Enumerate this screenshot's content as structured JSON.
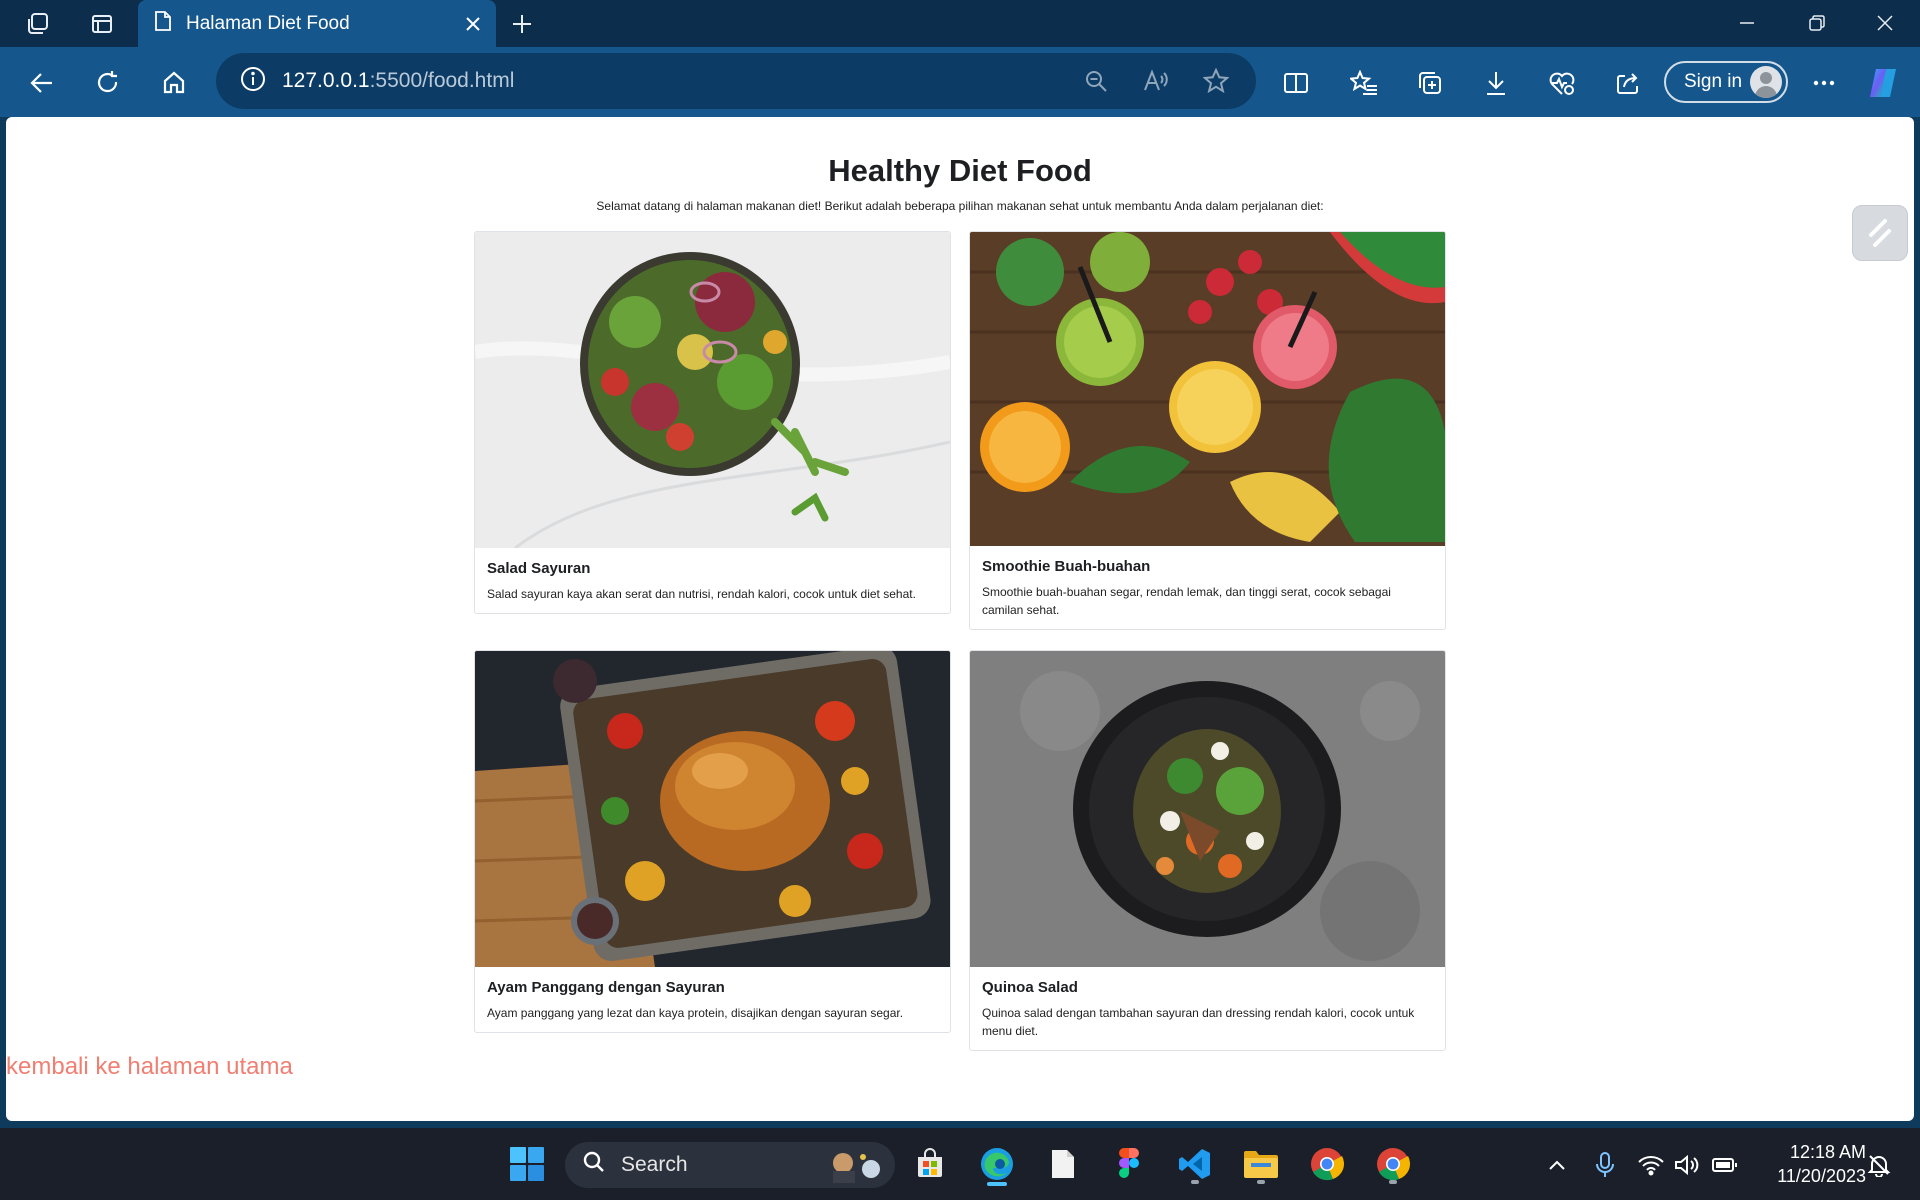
{
  "browser": {
    "tab_title": "Halaman Diet Food",
    "url_host": "127.0.0.1",
    "url_rest": ":5500/food.html",
    "sign_in": "Sign in"
  },
  "page": {
    "title": "Healthy Diet Food",
    "intro": "Selamat datang di halaman makanan diet! Berikut adalah beberapa pilihan makanan sehat untuk membantu Anda dalam perjalanan diet:",
    "back_link": "kembali ke halaman utama",
    "cards": [
      {
        "title": "Salad Sayuran",
        "text": "Salad sayuran kaya akan serat dan nutrisi, rendah kalori, cocok untuk diet sehat."
      },
      {
        "title": "Smoothie Buah-buahan",
        "text": "Smoothie buah-buahan segar, rendah lemak, dan tinggi serat, cocok sebagai camilan sehat."
      },
      {
        "title": "Ayam Panggang dengan Sayuran",
        "text": "Ayam panggang yang lezat dan kaya protein, disajikan dengan sayuran segar."
      },
      {
        "title": "Quinoa Salad",
        "text": "Quinoa salad dengan tambahan sayuran dan dressing rendah kalori, cocok untuk menu diet."
      }
    ]
  },
  "taskbar": {
    "search_label": "Search",
    "time": "12:18 AM",
    "date": "11/20/2023"
  },
  "colors": {
    "tab_active": "#15578c",
    "link": "#f07f72",
    "taskbar": "#1a1f29"
  }
}
